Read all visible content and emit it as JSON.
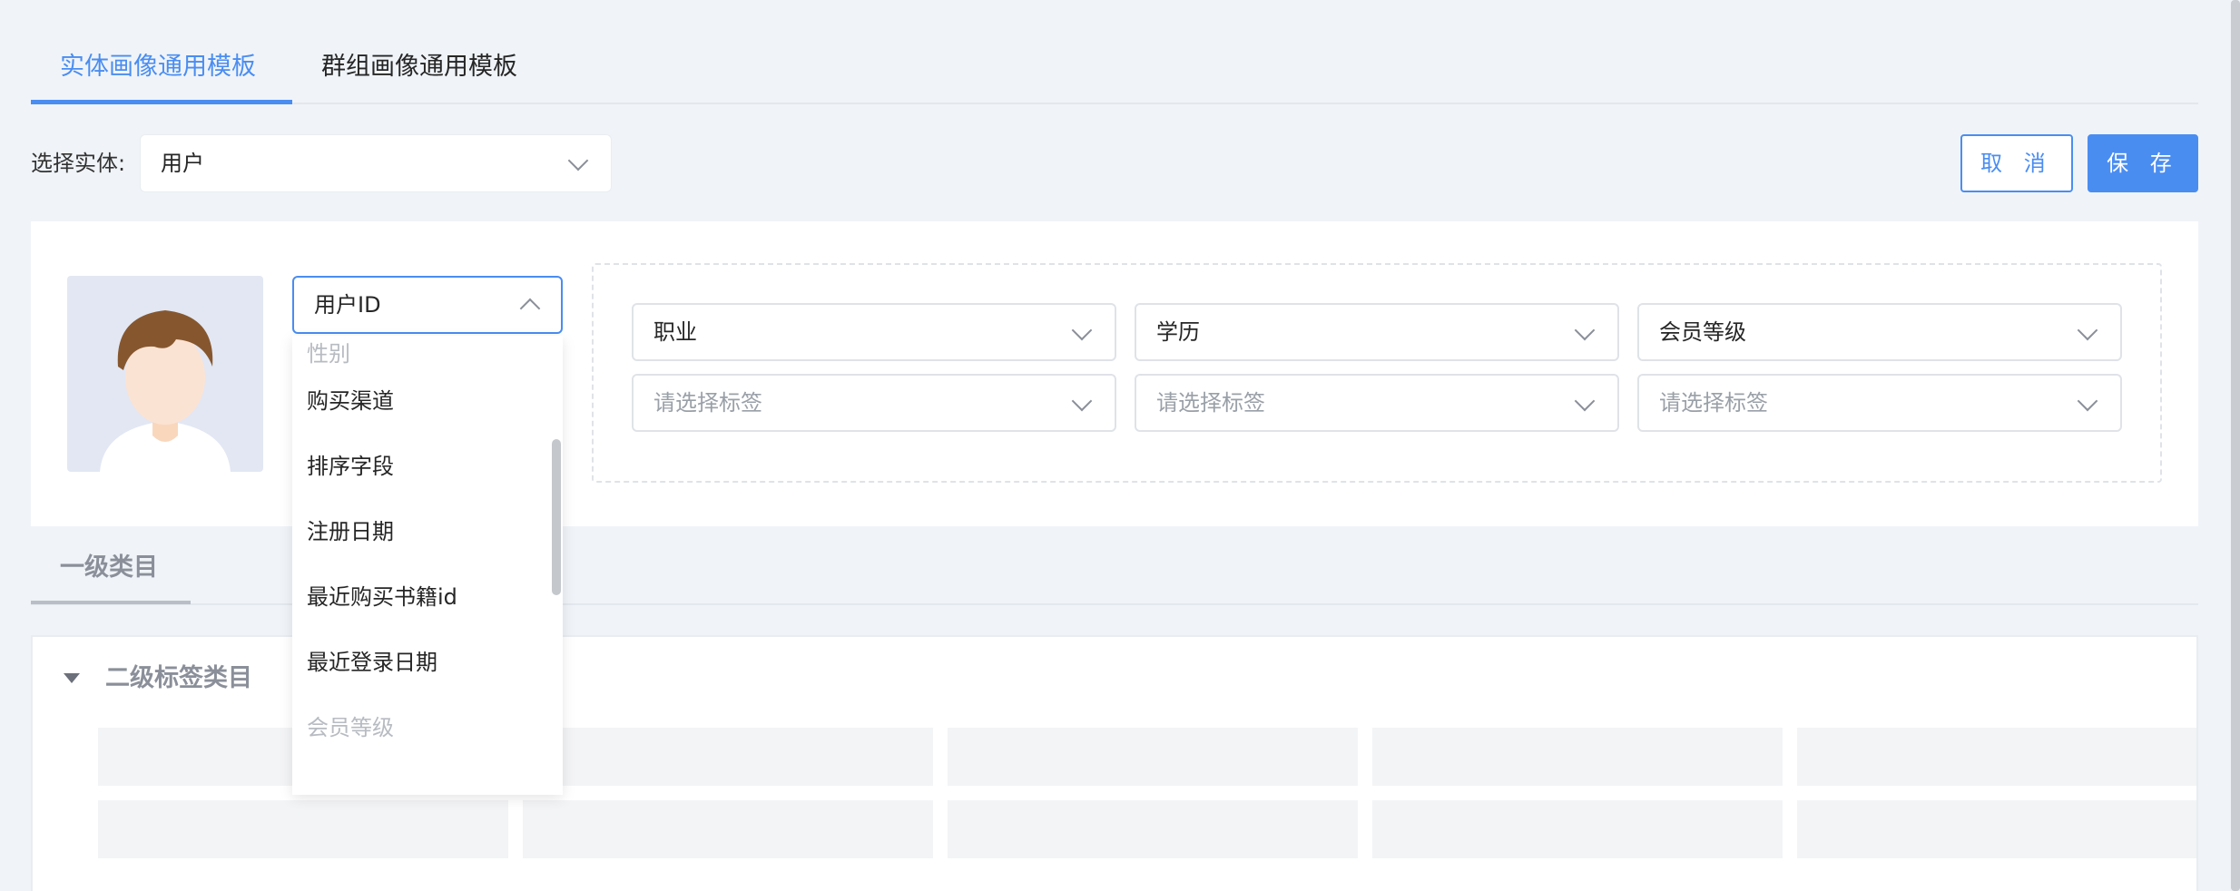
{
  "tabs": [
    {
      "label": "实体画像通用模板",
      "active": true
    },
    {
      "label": "群组画像通用模板",
      "active": false
    }
  ],
  "entity": {
    "label": "选择实体:",
    "value": "用户"
  },
  "actions": {
    "cancel_label": "取 消",
    "save_label": "保 存"
  },
  "id_field": {
    "value": "用户ID",
    "options": [
      "性别",
      "购买渠道",
      "排序字段",
      "注册日期",
      "最近购买书籍id",
      "最近登录日期",
      "会员等级"
    ]
  },
  "tag_selects": {
    "row1": [
      "职业",
      "学历",
      "会员等级"
    ],
    "row2_placeholder": "请选择标签"
  },
  "section": {
    "tab_label": "一级类目",
    "sub_title": "二级标签类目"
  },
  "colors": {
    "accent": "#4a8df1",
    "background": "#f0f4f8"
  },
  "icons": {
    "avatar": "person-avatar-icon",
    "dropdown": "chevron-down-icon",
    "collapse": "caret-down-icon"
  }
}
